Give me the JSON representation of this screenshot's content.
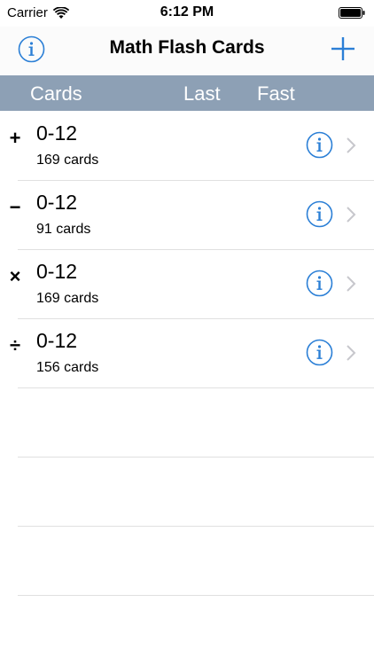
{
  "status_bar": {
    "carrier": "Carrier",
    "time": "6:12 PM"
  },
  "nav": {
    "title": "Math Flash Cards",
    "info_icon": "info-circle-icon",
    "add_icon": "plus-icon"
  },
  "header": {
    "cards": "Cards",
    "last": "Last",
    "fast": "Fast"
  },
  "colors": {
    "accent": "#2b7fd6",
    "header_bg": "#8da0b5",
    "chevron": "#c7c7cc"
  },
  "decks": [
    {
      "operation": "+",
      "operation_name": "plus",
      "title": "0-12",
      "count": "169 cards"
    },
    {
      "operation": "−",
      "operation_name": "minus",
      "title": "0-12",
      "count": "91 cards"
    },
    {
      "operation": "×",
      "operation_name": "times",
      "title": "0-12",
      "count": "169 cards"
    },
    {
      "operation": "÷",
      "operation_name": "divide",
      "title": "0-12",
      "count": "156 cards"
    }
  ]
}
